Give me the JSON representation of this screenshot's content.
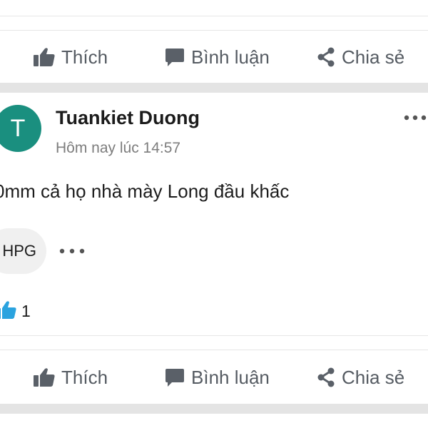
{
  "actions_top": {
    "like_label": "Thích",
    "comment_label": "Bình luận",
    "share_label": "Chia sẻ"
  },
  "post": {
    "avatar_letter": "T",
    "author": "Tuankiet Duong",
    "timestamp": "Hôm nay lúc 14:57",
    "text": "0mm cả họ nhà mày Long đầu khấc",
    "tag": "HPG",
    "like_count": "1",
    "actions": {
      "like_label": "Thích",
      "comment_label": "Bình luận",
      "share_label": "Chia sẻ"
    }
  },
  "colors": {
    "avatar_bg": "#1a8f7f",
    "like_icon": "#2aa3df",
    "action_text": "#555b62",
    "separator": "#e4e4e4"
  },
  "icons": [
    "thumbs-up-icon",
    "comment-icon",
    "share-icon",
    "more-dots-icon"
  ]
}
